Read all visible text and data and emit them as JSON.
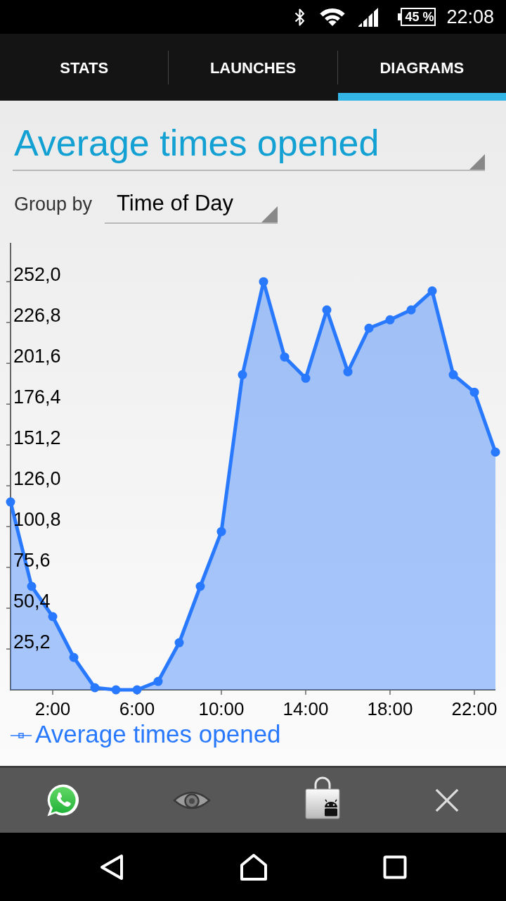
{
  "status_bar": {
    "battery": "45 %",
    "time": "22:08"
  },
  "tabs": [
    {
      "label": "STATS",
      "selected": false
    },
    {
      "label": "LAUNCHES",
      "selected": false
    },
    {
      "label": "DIAGRAMS",
      "selected": true
    }
  ],
  "metric_spinner": {
    "value": "Average times opened"
  },
  "group_by": {
    "label": "Group by",
    "value": "Time of Day"
  },
  "chart": {
    "chart_data": {
      "type": "area",
      "x": [
        0,
        1,
        2,
        3,
        4,
        5,
        6,
        7,
        8,
        9,
        10,
        11,
        12,
        13,
        14,
        15,
        16,
        17,
        18,
        19,
        20,
        21,
        22,
        23
      ],
      "xlim": [
        0,
        23
      ],
      "ylim": [
        0,
        276
      ],
      "xticks": [
        {
          "value": 2,
          "label": "2:00"
        },
        {
          "value": 6,
          "label": "6:00"
        },
        {
          "value": 10,
          "label": "10:00"
        },
        {
          "value": 14,
          "label": "14:00"
        },
        {
          "value": 18,
          "label": "18:00"
        },
        {
          "value": 22,
          "label": "22:00"
        }
      ],
      "yticks": [
        {
          "value": 25.2,
          "label": "25,2"
        },
        {
          "value": 50.4,
          "label": "50,4"
        },
        {
          "value": 75.6,
          "label": "75,6"
        },
        {
          "value": 100.8,
          "label": "100,8"
        },
        {
          "value": 126,
          "label": "126,0"
        },
        {
          "value": 151.2,
          "label": "151,2"
        },
        {
          "value": 176.4,
          "label": "176,4"
        },
        {
          "value": 201.6,
          "label": "201,6"
        },
        {
          "value": 226.8,
          "label": "226,8"
        },
        {
          "value": 252,
          "label": "252,0"
        }
      ],
      "series": [
        {
          "name": "Average times opened",
          "color": "#2979ff",
          "values": [
            116,
            63.9,
            45.2,
            20,
            1.3,
            0,
            0,
            5.2,
            29.1,
            63.9,
            97.7,
            194.6,
            252,
            205.5,
            192.4,
            234.6,
            196.4,
            223.3,
            228.5,
            234.6,
            246.3,
            194.6,
            183.8,
            146.8
          ]
        }
      ]
    }
  }
}
